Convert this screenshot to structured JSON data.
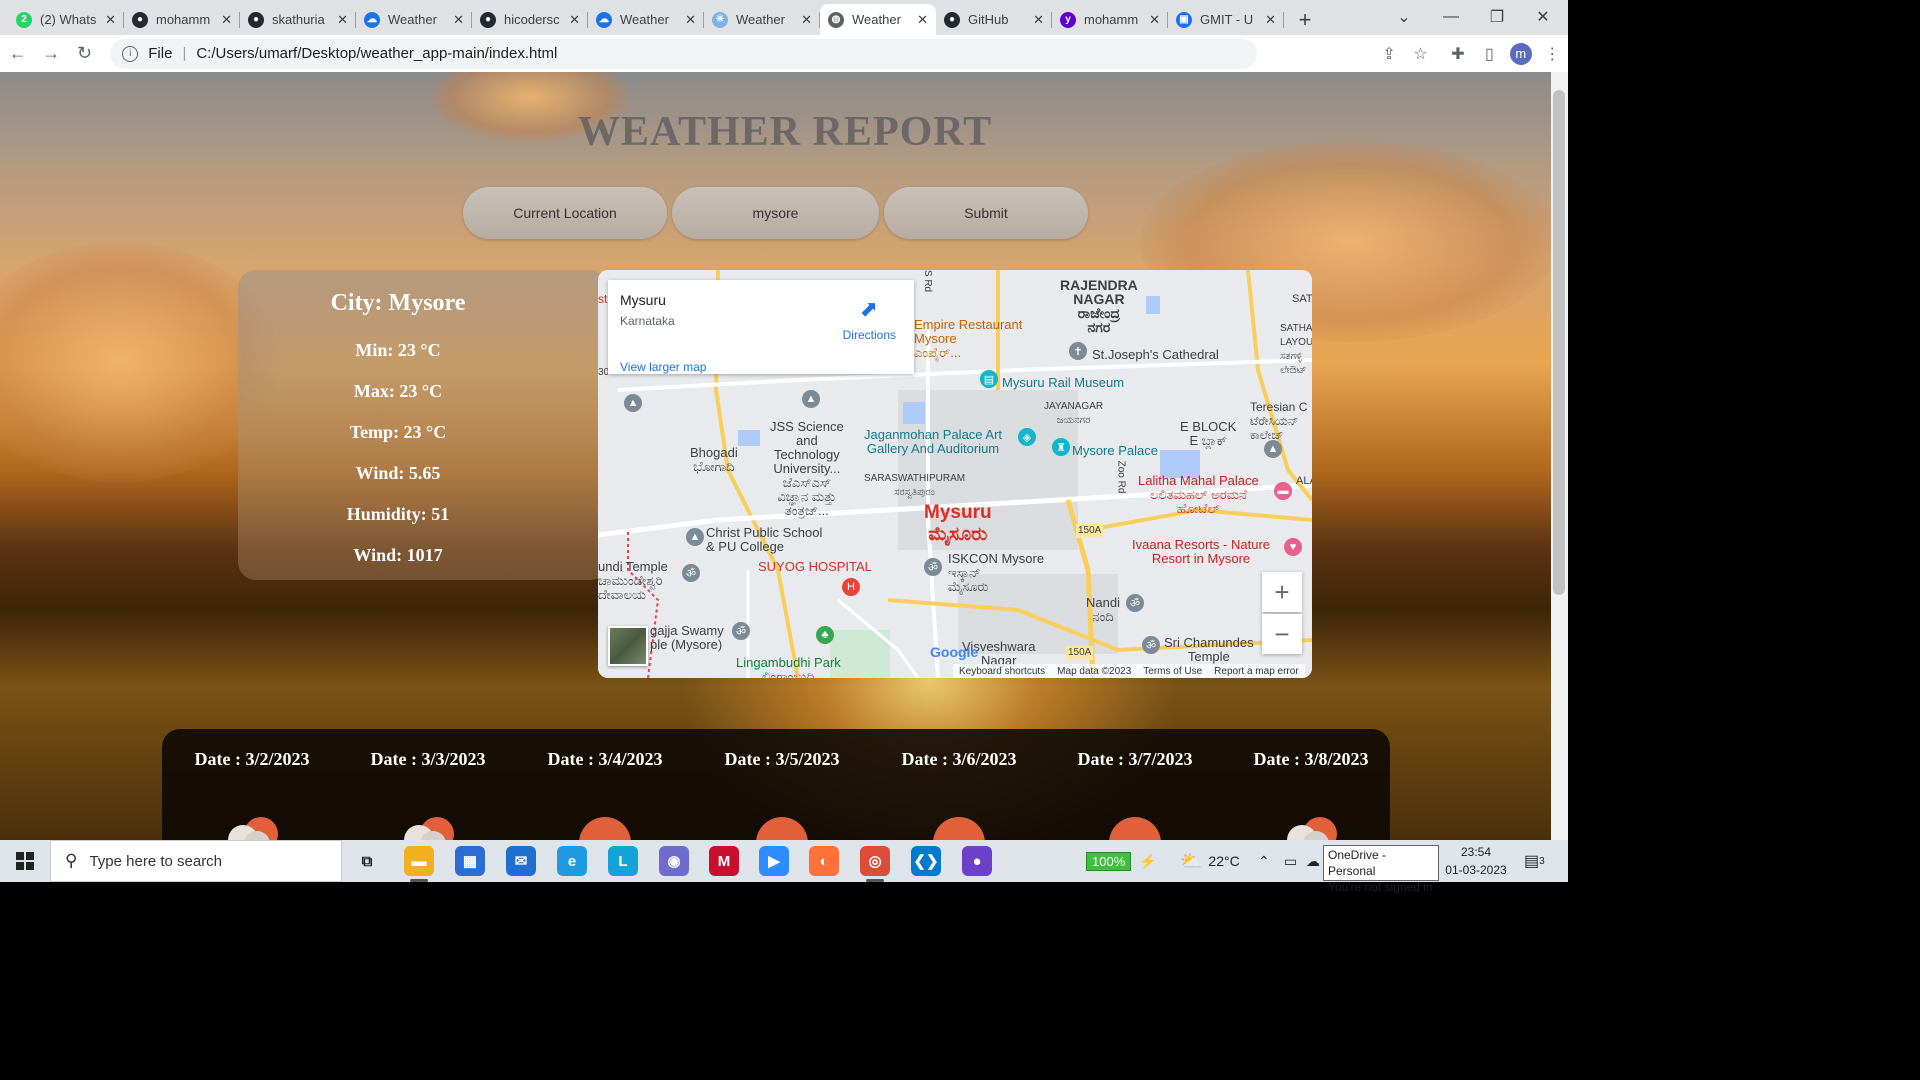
{
  "browser": {
    "tabs": [
      {
        "label": "(2) Whats",
        "icon": "whatsapp-icon",
        "color": "#25d366",
        "glyph": "2"
      },
      {
        "label": "mohamm",
        "icon": "github-icon",
        "color": "#24292f",
        "glyph": "●"
      },
      {
        "label": "skathuria",
        "icon": "github-icon",
        "color": "#24292f",
        "glyph": "●"
      },
      {
        "label": "Weather",
        "icon": "cloud-icon",
        "color": "#1a73e8",
        "glyph": "☁"
      },
      {
        "label": "hicodersc",
        "icon": "github-icon",
        "color": "#24292f",
        "glyph": "●"
      },
      {
        "label": "Weather",
        "icon": "cloud-icon",
        "color": "#1a73e8",
        "glyph": "☁"
      },
      {
        "label": "Weather",
        "icon": "weather-icon",
        "color": "#7fb3e6",
        "glyph": "☀"
      },
      {
        "label": "Weather",
        "icon": "globe-icon",
        "color": "#5f6368",
        "glyph": "◍",
        "active": true
      },
      {
        "label": "GitHub",
        "icon": "github-icon",
        "color": "#24292f",
        "glyph": "●"
      },
      {
        "label": "mohamm",
        "icon": "yahoo-icon",
        "color": "#6001d2",
        "glyph": "y"
      },
      {
        "label": "GMIT - U",
        "icon": "contacts-icon",
        "color": "#1a73e8",
        "glyph": "▣"
      }
    ],
    "address": {
      "scheme": "File",
      "url": "C:/Users/umarf/Desktop/weather_app-main/index.html"
    },
    "profile_initial": "m"
  },
  "page": {
    "heading": "WEATHER REPORT",
    "buttons": {
      "current_location": "Current Location",
      "city_input": "mysore",
      "submit": "Submit"
    },
    "info": {
      "city": "City: Mysore",
      "min": "Min: 23 °C",
      "max": "Max: 23 °C",
      "temp": "Temp: 23 °C",
      "wind": "Wind: 5.65",
      "humidity": "Humidity: 51",
      "wind2": "Wind: 1017"
    },
    "map": {
      "card_title": "Mysuru",
      "card_subtitle": "Karnataka",
      "view_larger": "View larger map",
      "directions": "Directions",
      "google": "Google",
      "footer": [
        "Keyboard shortcuts",
        "Map data ©2023",
        "Terms of Use",
        "Report a map error"
      ],
      "zoom_in": "+",
      "zoom_out": "−",
      "labels": {
        "rajendra": "RAJENDRA\nNAGAR\nರಾಜೇಂದ್ರ\nನಗರ",
        "empire": "Empire Restaurant\nMysore\nಎಂಪೈರ್...",
        "stjoseph": "St.Joseph's Cathedral",
        "railmuseum": "Mysuru Rail Museum",
        "jayanagar": "JAYANAGAR\nಜಯನಗರ",
        "eblock": "E BLOCK\nE ಬ್ಲಾಕ್",
        "teresian": "Teresian C\nಟೆರೇಸಿಯನ್\nಕಾಲೇಜ್",
        "jss": "JSS Science\nand\nTechnology\nUniversity...\nಜೆಎಸ್ಎಸ್\nವಿಜ್ಞಾನ ಮತ್ತು\nತಂತ್ರಜ್...",
        "bhogadi": "Bhogadi\nಭೋಗಾದಿ",
        "jagan": "Jaganmohan Palace Art\nGallery And Auditorium",
        "mysorepalace": "Mysore Palace",
        "saraswathi": "SARASWATHIPURAM\nಸರಸ್ವತಿಪುರಂ",
        "lalitha": "Lalitha Mahal Palace\nಲಲಿತಮಹಲ್ ಅರಮನೆ\nಹೋಟೆಲ್",
        "mysuru": "Mysuru\nಮೈಸೂರು",
        "christ": "Christ Public School\n& PU College",
        "ivaana": "Ivaana Resorts - Nature\nResort in Mysore",
        "suyog": "SUYOG HOSPITAL",
        "iskcon": "ISKCON Mysore\nಇಸ್ಕಾನ್\nಮೈಸೂರು",
        "temple": "undi Temple\nಚಾಮುಂಡೇಶ್ವರಿ\nದೇವಾಲಯ",
        "nandi": "Nandi\nನಂದಿ",
        "ganapathy": "gajja Swamy\nple (Mysore)",
        "lingambudhi": "Lingambudhi Park\nಲಿಂಗಾಂಬುಧಿ",
        "visveshwara": "Visveshwara\nNagar",
        "chamundes": "Sri Chamundes\nTemple",
        "sathagalli": "SATHAGA\nLAYOU\nಸತಗಳ್ಳಿ\nಲೇಔಟ್",
        "sat": "SAT",
        "ala": "ALA",
        "r150a1": "150A",
        "r150a2": "150A",
        "zooroad": "Zoo Rd",
        "srd": "S Rd",
        "st": "st",
        "thirty": "30"
      }
    },
    "forecast": [
      {
        "date": "Date : 3/2/2023",
        "icon": "cloudy-sun-icon"
      },
      {
        "date": "Date : 3/3/2023",
        "icon": "cloudy-sun-icon"
      },
      {
        "date": "Date : 3/4/2023",
        "icon": "sun-icon"
      },
      {
        "date": "Date : 3/5/2023",
        "icon": "sun-icon"
      },
      {
        "date": "Date : 3/6/2023",
        "icon": "sun-icon"
      },
      {
        "date": "Date : 3/7/2023",
        "icon": "sun-icon"
      },
      {
        "date": "Date : 3/8/2023",
        "icon": "cloudy-sun-icon"
      }
    ]
  },
  "taskbar": {
    "search_placeholder": "Type here to search",
    "battery": "100%",
    "temperature": "22°C",
    "onedrive_line1": "OneDrive - Personal",
    "onedrive_line2": "You're not signed in",
    "time": "23:54",
    "date": "01-03-2023",
    "notifications": "3",
    "apps": [
      {
        "name": "task-view-icon",
        "color": "#dfe3ea",
        "glyph": "⧉"
      },
      {
        "name": "file-explorer-icon",
        "color": "#f2b01e",
        "glyph": "▬"
      },
      {
        "name": "microsoft-store-icon",
        "color": "#2b6cd6",
        "glyph": "▦"
      },
      {
        "name": "mail-icon",
        "color": "#1f6fd1",
        "glyph": "✉"
      },
      {
        "name": "edge-icon",
        "color": "#1e9be0",
        "glyph": "e"
      },
      {
        "name": "l-app-icon",
        "color": "#13a3d8",
        "glyph": "L"
      },
      {
        "name": "camera-app-icon",
        "color": "#6f6ccf",
        "glyph": "◉"
      },
      {
        "name": "mcafee-icon",
        "color": "#c8102e",
        "glyph": "M"
      },
      {
        "name": "zoom-icon",
        "color": "#2d8cff",
        "glyph": "▶"
      },
      {
        "name": "firefox-icon",
        "color": "#ff7139",
        "glyph": "◐"
      },
      {
        "name": "chrome-icon",
        "color": "#dd4b39",
        "glyph": "◎"
      },
      {
        "name": "vscode-icon",
        "color": "#007acc",
        "glyph": "❮❯"
      },
      {
        "name": "github-desktop-icon",
        "color": "#6e40c9",
        "glyph": "●"
      }
    ]
  }
}
